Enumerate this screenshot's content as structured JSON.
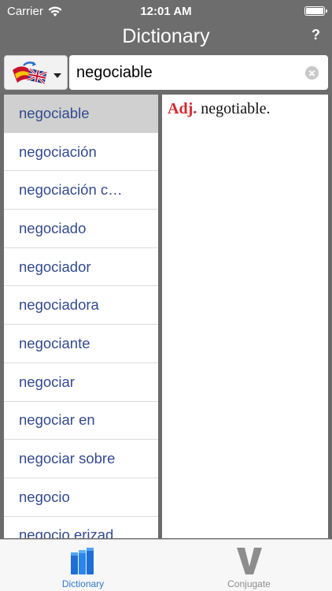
{
  "status": {
    "carrier": "Carrier",
    "time": "12:01 AM"
  },
  "nav": {
    "title": "Dictionary",
    "help_label": "?"
  },
  "search": {
    "value": "negociable",
    "language_pair": "spanish-english-flag-icon"
  },
  "results": [
    {
      "label": "negociable",
      "selected": true
    },
    {
      "label": "negociación",
      "selected": false
    },
    {
      "label": "negociación c…",
      "selected": false
    },
    {
      "label": "negociado",
      "selected": false
    },
    {
      "label": "negociador",
      "selected": false
    },
    {
      "label": "negociadora",
      "selected": false
    },
    {
      "label": "negociante",
      "selected": false
    },
    {
      "label": "negociar",
      "selected": false
    },
    {
      "label": "negociar en",
      "selected": false
    },
    {
      "label": "negociar sobre",
      "selected": false
    },
    {
      "label": "negocio",
      "selected": false
    },
    {
      "label": "negocio erizad",
      "selected": false
    }
  ],
  "definition": {
    "part_of_speech": "Adj.",
    "text": "negotiable."
  },
  "tabs": [
    {
      "label": "Dictionary",
      "icon": "books-icon",
      "active": true
    },
    {
      "label": "Conjugate",
      "icon": "conjugate-v-icon",
      "active": false
    }
  ],
  "colors": {
    "bar_gray": "#6d6d6d",
    "result_text": "#334b8f",
    "pos_red": "#d3282f",
    "tab_active": "#2e7ad0"
  }
}
